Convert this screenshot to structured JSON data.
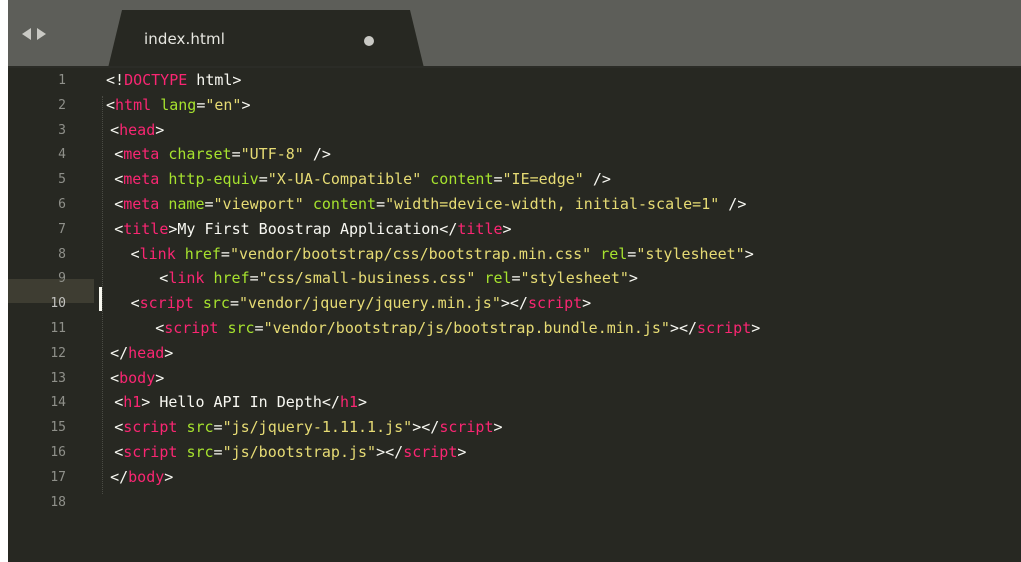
{
  "tab": {
    "title": "index.html",
    "modified": true
  },
  "editor": {
    "current_line": 10,
    "lines": [
      {
        "n": "1",
        "indent": 0,
        "tokens": [
          [
            "<!",
            "pl"
          ],
          [
            "DOCTYPE",
            "tg"
          ],
          [
            " html>",
            "pl"
          ]
        ]
      },
      {
        "n": "2",
        "indent": 0,
        "tokens": [
          [
            "<",
            "pl"
          ],
          [
            "html",
            "tg"
          ],
          [
            " ",
            "pl"
          ],
          [
            "lang",
            "at"
          ],
          [
            "=",
            "pl"
          ],
          [
            "\"en\"",
            "st"
          ],
          [
            ">",
            "pl"
          ]
        ]
      },
      {
        "n": "3",
        "indent": 1,
        "tokens": [
          [
            "<",
            "pl"
          ],
          [
            "head",
            "tg"
          ],
          [
            ">",
            "pl"
          ]
        ]
      },
      {
        "n": "4",
        "indent": 2,
        "tokens": [
          [
            "<",
            "pl"
          ],
          [
            "meta",
            "tg"
          ],
          [
            " ",
            "pl"
          ],
          [
            "charset",
            "at"
          ],
          [
            "=",
            "pl"
          ],
          [
            "\"UTF-8\"",
            "st"
          ],
          [
            " />",
            "pl"
          ]
        ]
      },
      {
        "n": "5",
        "indent": 2,
        "tokens": [
          [
            "<",
            "pl"
          ],
          [
            "meta",
            "tg"
          ],
          [
            " ",
            "pl"
          ],
          [
            "http-equiv",
            "at"
          ],
          [
            "=",
            "pl"
          ],
          [
            "\"X-UA-Compatible\"",
            "st"
          ],
          [
            " ",
            "pl"
          ],
          [
            "content",
            "at"
          ],
          [
            "=",
            "pl"
          ],
          [
            "\"IE=edge\"",
            "st"
          ],
          [
            " />",
            "pl"
          ]
        ]
      },
      {
        "n": "6",
        "indent": 2,
        "tokens": [
          [
            "<",
            "pl"
          ],
          [
            "meta",
            "tg"
          ],
          [
            " ",
            "pl"
          ],
          [
            "name",
            "at"
          ],
          [
            "=",
            "pl"
          ],
          [
            "\"viewport\"",
            "st"
          ],
          [
            " ",
            "pl"
          ],
          [
            "content",
            "at"
          ],
          [
            "=",
            "pl"
          ],
          [
            "\"width=device-width, initial-scale=1\"",
            "st"
          ],
          [
            " />",
            "pl"
          ]
        ]
      },
      {
        "n": "7",
        "indent": 2,
        "tokens": [
          [
            "<",
            "pl"
          ],
          [
            "title",
            "tg"
          ],
          [
            ">My First Boostrap Application</",
            "pl"
          ],
          [
            "title",
            "tg"
          ],
          [
            ">",
            "pl"
          ]
        ]
      },
      {
        "n": "8",
        "indent": 6,
        "tokens": [
          [
            "<",
            "pl"
          ],
          [
            "link",
            "tg"
          ],
          [
            " ",
            "pl"
          ],
          [
            "href",
            "at"
          ],
          [
            "=",
            "pl"
          ],
          [
            "\"vendor/bootstrap/css/bootstrap.min.css\"",
            "st"
          ],
          [
            " ",
            "pl"
          ],
          [
            "rel",
            "at"
          ],
          [
            "=",
            "pl"
          ],
          [
            "\"stylesheet\"",
            "st"
          ],
          [
            ">",
            "pl"
          ]
        ]
      },
      {
        "n": "9",
        "indent": 13,
        "tokens": [
          [
            "<",
            "pl"
          ],
          [
            "link",
            "tg"
          ],
          [
            " ",
            "pl"
          ],
          [
            "href",
            "at"
          ],
          [
            "=",
            "pl"
          ],
          [
            "\"css/small-business.css\"",
            "st"
          ],
          [
            " ",
            "pl"
          ],
          [
            "rel",
            "at"
          ],
          [
            "=",
            "pl"
          ],
          [
            "\"stylesheet\"",
            "st"
          ],
          [
            ">",
            "pl"
          ]
        ]
      },
      {
        "n": "10",
        "indent": 6,
        "tokens": [
          [
            "<",
            "pl"
          ],
          [
            "script",
            "tg"
          ],
          [
            " ",
            "pl"
          ],
          [
            "src",
            "at"
          ],
          [
            "=",
            "pl"
          ],
          [
            "\"vendor/jquery/jquery.min.js\"",
            "st"
          ],
          [
            "></",
            "pl"
          ],
          [
            "script",
            "tg"
          ],
          [
            ">",
            "pl"
          ]
        ]
      },
      {
        "n": "11",
        "indent": 12,
        "tokens": [
          [
            "<",
            "pl"
          ],
          [
            "script",
            "tg"
          ],
          [
            " ",
            "pl"
          ],
          [
            "src",
            "at"
          ],
          [
            "=",
            "pl"
          ],
          [
            "\"vendor/bootstrap/js/bootstrap.bundle.min.js\"",
            "st"
          ],
          [
            "></",
            "pl"
          ],
          [
            "script",
            "tg"
          ],
          [
            ">",
            "pl"
          ]
        ]
      },
      {
        "n": "12",
        "indent": 1,
        "tokens": [
          [
            "</",
            "pl"
          ],
          [
            "head",
            "tg"
          ],
          [
            ">",
            "pl"
          ]
        ]
      },
      {
        "n": "13",
        "indent": 1,
        "tokens": [
          [
            "<",
            "pl"
          ],
          [
            "body",
            "tg"
          ],
          [
            ">",
            "pl"
          ]
        ]
      },
      {
        "n": "14",
        "indent": 2,
        "tokens": [
          [
            "<",
            "pl"
          ],
          [
            "h1",
            "tg"
          ],
          [
            "> Hello API In Depth</",
            "pl"
          ],
          [
            "h1",
            "tg"
          ],
          [
            ">",
            "pl"
          ]
        ]
      },
      {
        "n": "15",
        "indent": 2,
        "tokens": [
          [
            "<",
            "pl"
          ],
          [
            "script",
            "tg"
          ],
          [
            " ",
            "pl"
          ],
          [
            "src",
            "at"
          ],
          [
            "=",
            "pl"
          ],
          [
            "\"js/jquery-1.11.1.js\"",
            "st"
          ],
          [
            "></",
            "pl"
          ],
          [
            "script",
            "tg"
          ],
          [
            ">",
            "pl"
          ]
        ]
      },
      {
        "n": "16",
        "indent": 2,
        "tokens": [
          [
            "<",
            "pl"
          ],
          [
            "script",
            "tg"
          ],
          [
            " ",
            "pl"
          ],
          [
            "src",
            "at"
          ],
          [
            "=",
            "pl"
          ],
          [
            "\"js/bootstrap.js\"",
            "st"
          ],
          [
            "></",
            "pl"
          ],
          [
            "script",
            "tg"
          ],
          [
            ">",
            "pl"
          ]
        ]
      },
      {
        "n": "17",
        "indent": 1,
        "tokens": [
          [
            "</",
            "pl"
          ],
          [
            "body",
            "tg"
          ],
          [
            ">",
            "pl"
          ]
        ]
      },
      {
        "n": "18",
        "indent": 0,
        "tokens": []
      }
    ]
  },
  "colors": {
    "background": "#272822",
    "tag": "#f92672",
    "attribute": "#a6e22e",
    "string": "#e6db74",
    "text": "#f8f8f2",
    "gutter_number": "#8f908a",
    "tabbar": "#5d5e59"
  }
}
